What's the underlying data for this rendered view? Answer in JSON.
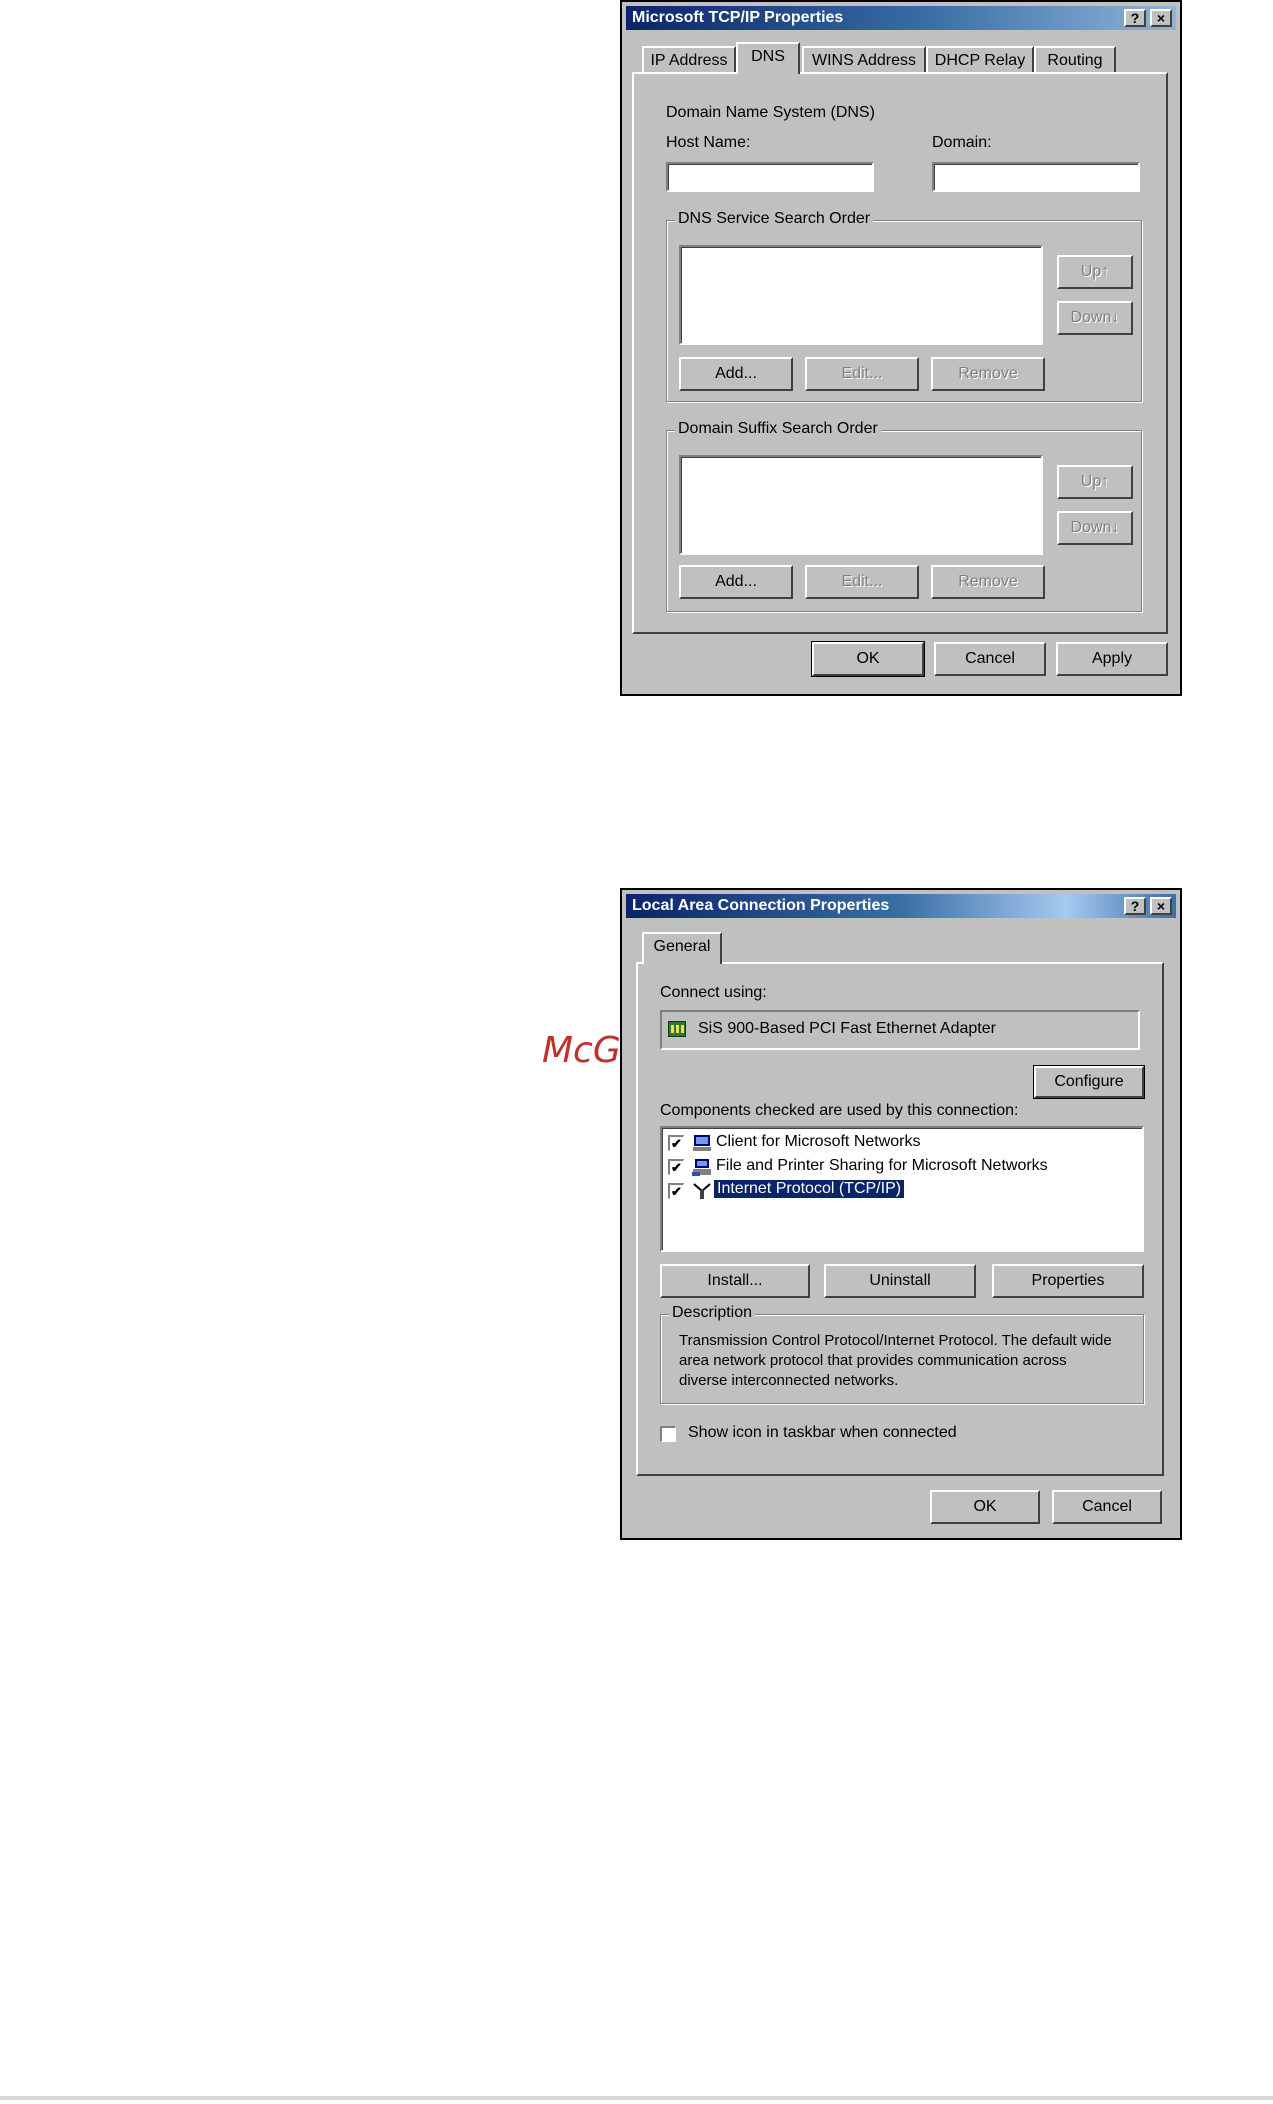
{
  "watermark": "McGrp.Ru",
  "tcpip": {
    "title": "Microsoft TCP/IP Properties",
    "help": "?",
    "close": "×",
    "tabs": [
      "IP Address",
      "DNS",
      "WINS Address",
      "DHCP Relay",
      "Routing"
    ],
    "dns_label": "Domain Name System (DNS)",
    "host_label": "Host Name:",
    "domain_label": "Domain:",
    "host_value": "",
    "domain_value": "",
    "search_group": "DNS Service Search Order",
    "suffix_group": "Domain Suffix Search Order",
    "up": "Up↑",
    "down": "Down↓",
    "add": "Add...",
    "edit": "Edit...",
    "remove": "Remove",
    "ok": "OK",
    "cancel": "Cancel",
    "apply": "Apply"
  },
  "lan": {
    "title": "Local Area Connection Properties",
    "help": "?",
    "close": "×",
    "tab": "General",
    "connect_using": "Connect using:",
    "adapter": "SiS 900-Based PCI Fast Ethernet Adapter",
    "configure": "Configure",
    "components_label": "Components checked are used by this connection:",
    "components": [
      {
        "label": "Client for Microsoft Networks",
        "checked": "✔"
      },
      {
        "label": "File and Printer Sharing for Microsoft Networks",
        "checked": "✔"
      },
      {
        "label": "Internet Protocol (TCP/IP)",
        "checked": "✔"
      }
    ],
    "install": "Install...",
    "uninstall": "Uninstall",
    "properties": "Properties",
    "description_title": "Description",
    "description": "Transmission Control Protocol/Internet Protocol. The default wide area network protocol that provides communication across diverse interconnected networks.",
    "show_icon": "Show icon in taskbar when connected",
    "ok": "OK",
    "cancel": "Cancel"
  }
}
